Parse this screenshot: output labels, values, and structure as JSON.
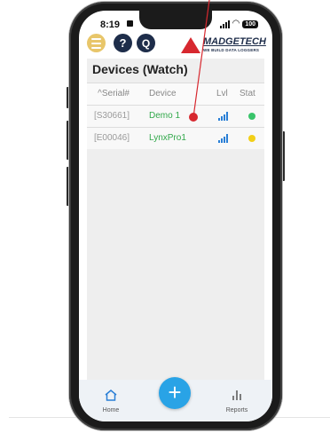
{
  "status_bar": {
    "time": "8:19",
    "battery": "100"
  },
  "header": {
    "help": "?",
    "q": "Q",
    "logo": {
      "name": "MADGETECH",
      "tagline": "WE BUILD DATA LOGGERS"
    }
  },
  "page": {
    "title": "Devices (Watch)"
  },
  "table": {
    "columns": [
      "^Serial#",
      "Device",
      "Lvl",
      "Stat"
    ],
    "rows": [
      {
        "serial": "[S30661]",
        "device": "Demo 1",
        "status_color": "#39c46a"
      },
      {
        "serial": "[E00046]",
        "device": "LynxPro1",
        "status_color": "#f2cf17"
      }
    ]
  },
  "nav": {
    "home": "Home",
    "reports": "Reports",
    "add": "+"
  },
  "colors": {
    "accent": "#29a3e6",
    "device_text": "#31a84a",
    "annotation": "#d7282f"
  }
}
